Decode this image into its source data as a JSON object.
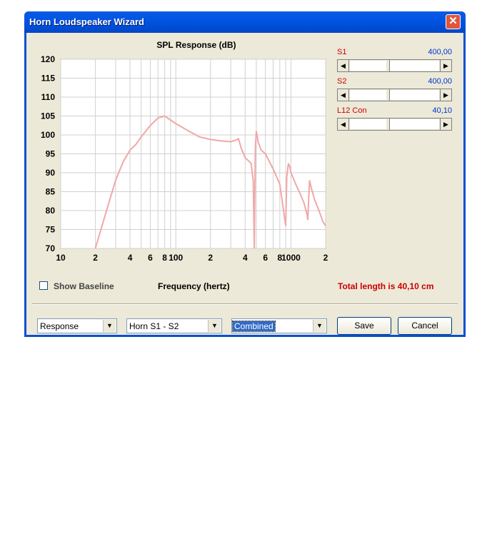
{
  "window": {
    "title": "Horn Loudspeaker Wizard"
  },
  "chart_data": {
    "type": "line",
    "title": "SPL Response (dB)",
    "xlabel": "Frequency (hertz)",
    "ylabel": "",
    "xscale": "log",
    "xlim": [
      10,
      2000
    ],
    "ylim": [
      70,
      120
    ],
    "yticks": [
      "120",
      "115",
      "110",
      "105",
      "100",
      "95",
      "90",
      "85",
      "80",
      "75",
      "70"
    ],
    "xticks": [
      "10",
      "2",
      "4",
      "6",
      "8",
      "100",
      "2",
      "4",
      "6",
      "8",
      "1000",
      "2"
    ],
    "grid": true,
    "series": [
      {
        "color": "#f0a8a8",
        "x": [
          20,
          25,
          30,
          35,
          40,
          45,
          50,
          60,
          70,
          80,
          100,
          130,
          160,
          200,
          250,
          300,
          330,
          350,
          370,
          400,
          450,
          470,
          480,
          490,
          500,
          520,
          550,
          600,
          700,
          800,
          900,
          920,
          950,
          980,
          1000,
          1100,
          1200,
          1300,
          1380,
          1400,
          1420,
          1450,
          1500,
          1600,
          1700,
          1800,
          1900,
          2000
        ],
        "y": [
          70,
          80,
          88,
          93,
          96,
          97.5,
          99.5,
          102.5,
          104.5,
          105,
          103,
          101,
          99.5,
          98.8,
          98.4,
          98.2,
          98.6,
          99,
          96.5,
          94,
          92.5,
          88,
          70,
          96,
          101,
          98,
          96,
          95,
          91,
          87,
          76,
          89,
          92.5,
          91.5,
          90,
          87,
          84.5,
          82,
          79,
          77.5,
          82,
          88,
          86,
          83,
          81,
          79,
          77,
          76
        ]
      }
    ]
  },
  "sliders": [
    {
      "label": "S1",
      "value": "400,00",
      "fraction": 0.5
    },
    {
      "label": "S2",
      "value": "400,00",
      "fraction": 0.5
    },
    {
      "label": "L12  Con",
      "value": "40,10",
      "fraction": 0.5
    }
  ],
  "show_baseline": {
    "label": "Show Baseline",
    "checked": false
  },
  "total_length": "Total length is 40,10 cm",
  "combos": [
    {
      "value": "Response"
    },
    {
      "value": "Horn S1 - S2"
    },
    {
      "value": "Combined"
    }
  ],
  "buttons": {
    "save": "Save",
    "cancel": "Cancel"
  },
  "icons": {
    "close": "close-icon",
    "dropdown": "chevron-down-icon",
    "left": "arrow-left-icon",
    "right": "arrow-right-icon"
  }
}
